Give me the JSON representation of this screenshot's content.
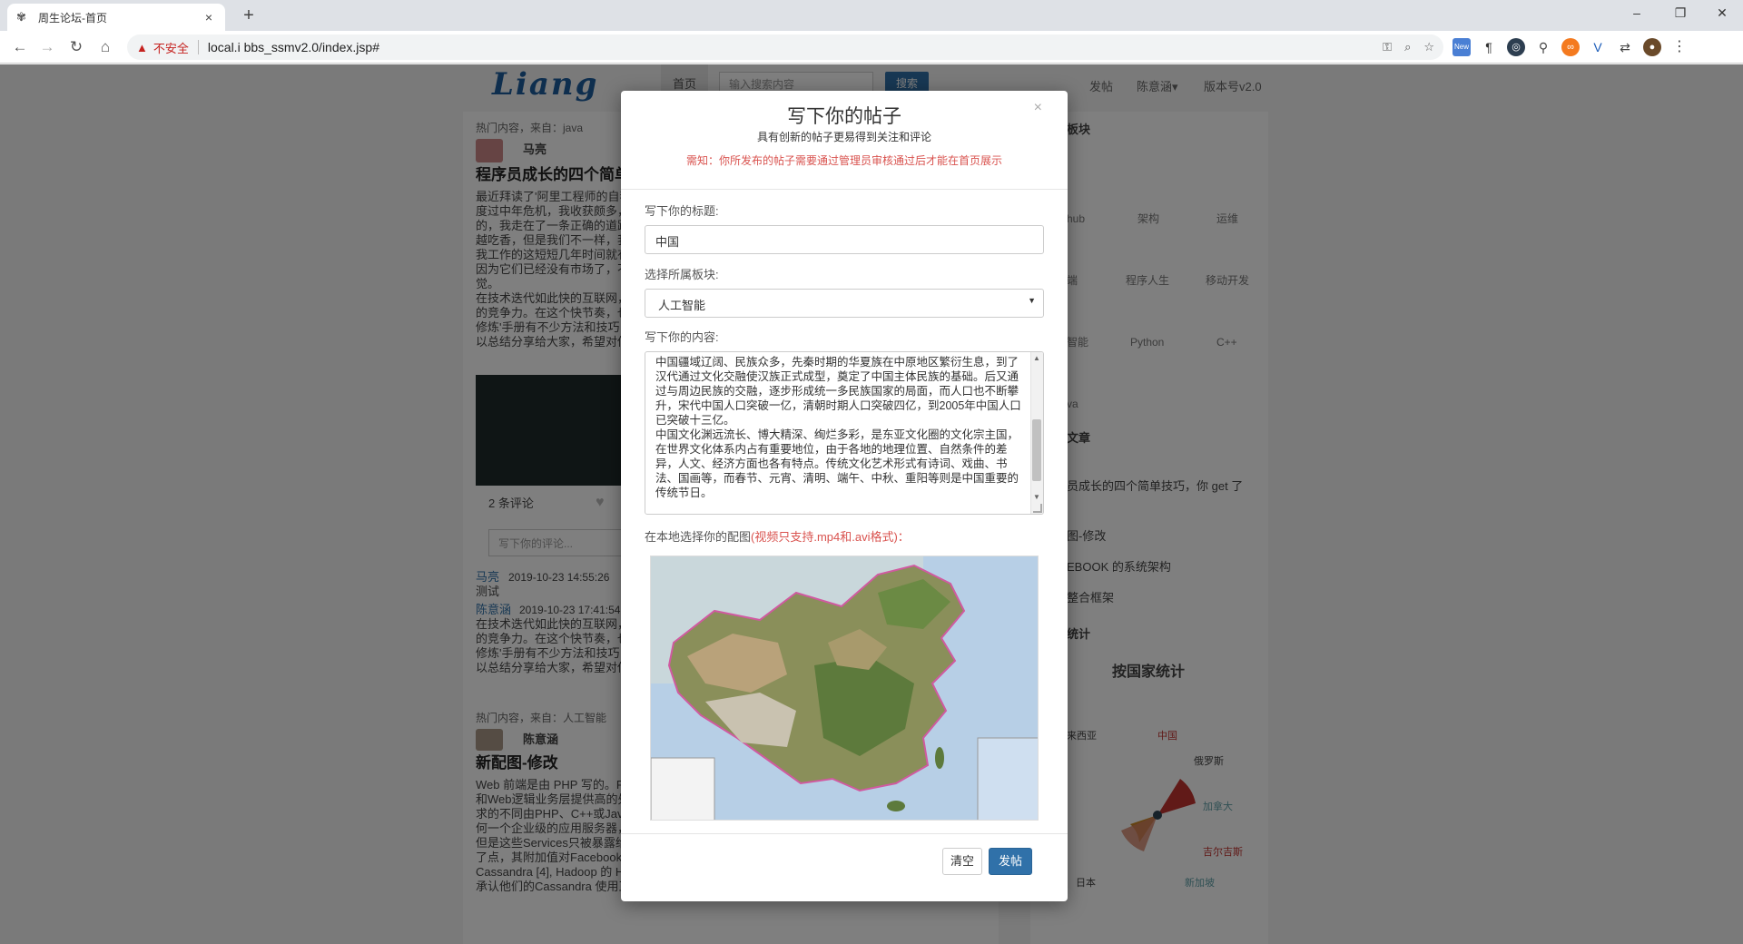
{
  "browser": {
    "tab_title": "周生论坛-首页",
    "tab_close": "×",
    "new_tab": "+",
    "insecure_label": "不安全",
    "url": "local.i          bbs_ssmv2.0/index.jsp#",
    "window_min": "–",
    "window_restore": "❐",
    "window_close": "✕",
    "ext_new_label": "New"
  },
  "site": {
    "logo": "Liang",
    "nav_home": "首页",
    "search_placeholder": "输入搜索内容",
    "search_btn": "搜索",
    "nav_post": "发帖",
    "nav_user": "陈意涵▾",
    "nav_version": "版本号v2.0"
  },
  "background": {
    "post1_meta": "热门内容，来自：java",
    "post1_author": "马亮",
    "post1_title": "程序员成长的四个简单",
    "post1_body": "最近拜读了'阿里工程师的自我\n度过中年危机，我收获颇多，\n的，我走在了一条正确的道路\n越吃香，但是我们不一样，我\n我工作的这短短几年时间就有\n因为它们已经没有市场了，不\n觉。\n在技术迭代如此快的互联网，\n的竞争力。在这个快节奏，也\n修炼'手册有不少方法和技巧\n以总结分享给大家，希望对你",
    "post1_comments": "2 条评论",
    "comment_placeholder": "写下你的评论...",
    "c1_user": "马亮",
    "c1_time": "2019-10-23 14:55:26",
    "c1_text": "测试",
    "c2_user": "陈意涵",
    "c2_time": "2019-10-23 17:41:54",
    "c2_text": "在技术迭代如此快的互联网，\n的竞争力。在这个快节奏，也\n修炼'手册有不少方法和技巧\n以总结分享给大家，希望对你",
    "post2_meta": "热门内容，来自：人工智能",
    "post2_author": "陈意涵",
    "post2_title": "新配图-修改",
    "post2_body": "Web 前端是由 PHP 写的。F\n和Web逻辑业务层提供高的处\n求的不同由PHP、C++或Java\n何一个企业级的应用服务器，\n但是这些Services只被暴露给\n了点，其附加值对Facebook\nCassandra [4], Hadoop 的 H\n承认他们的Cassandra 使用正在减少，因为他们更喜欢HBase，因为它的更简单的一致性模型，以到其",
    "board_title": "板块",
    "boards": [
      "hub",
      "架构",
      "运维",
      "端",
      "程序人生",
      "移动开发",
      "智能",
      "Python",
      "C++",
      "va"
    ],
    "articles_title": "文章",
    "articles": [
      "员成长的四个简单技巧，你 get 了",
      "图-修改",
      "EBOOK 的系统架构",
      "整合框架"
    ],
    "stats_title": "统计",
    "chart_title": "按国家统计",
    "chart_labels": [
      "来西亚",
      "中国",
      "俄罗斯",
      "加拿大",
      "吉尔吉斯",
      "新加坡",
      "日本"
    ]
  },
  "modal": {
    "close": "×",
    "title": "写下你的帖子",
    "subtitle": "具有创新的帖子更易得到关注和评论",
    "notice": "需知：你所发布的帖子需要通过管理员审核通过后才能在首页展示",
    "title_label": "写下你的标题:",
    "title_value": "中国",
    "board_label": "选择所属板块:",
    "board_value": "人工智能",
    "content_label": "写下你的内容:",
    "content_value": "中国疆域辽阔、民族众多，先秦时期的华夏族在中原地区繁衍生息，到了汉代通过文化交融使汉族正式成型，奠定了中国主体民族的基础。后又通过与周边民族的交融，逐步形成统一多民族国家的局面，而人口也不断攀升，宋代中国人口突破一亿，清朝时期人口突破四亿，到2005年中国人口已突破十三亿。\n中国文化渊远流长、博大精深、绚烂多彩，是东亚文化圈的文化宗主国，在世界文化体系内占有重要地位，由于各地的地理位置、自然条件的差异，人文、经济方面也各有特点。传统文化艺术形式有诗词、戏曲、书法、国画等，而春节、元宵、清明、端午、中秋、重阳等则是中国重要的传统节日。",
    "image_label": "在本地选择你的配图",
    "image_hint": "(视频只支持.mp4和.avi格式)：",
    "clear_btn": "清空",
    "post_btn": "发帖"
  }
}
